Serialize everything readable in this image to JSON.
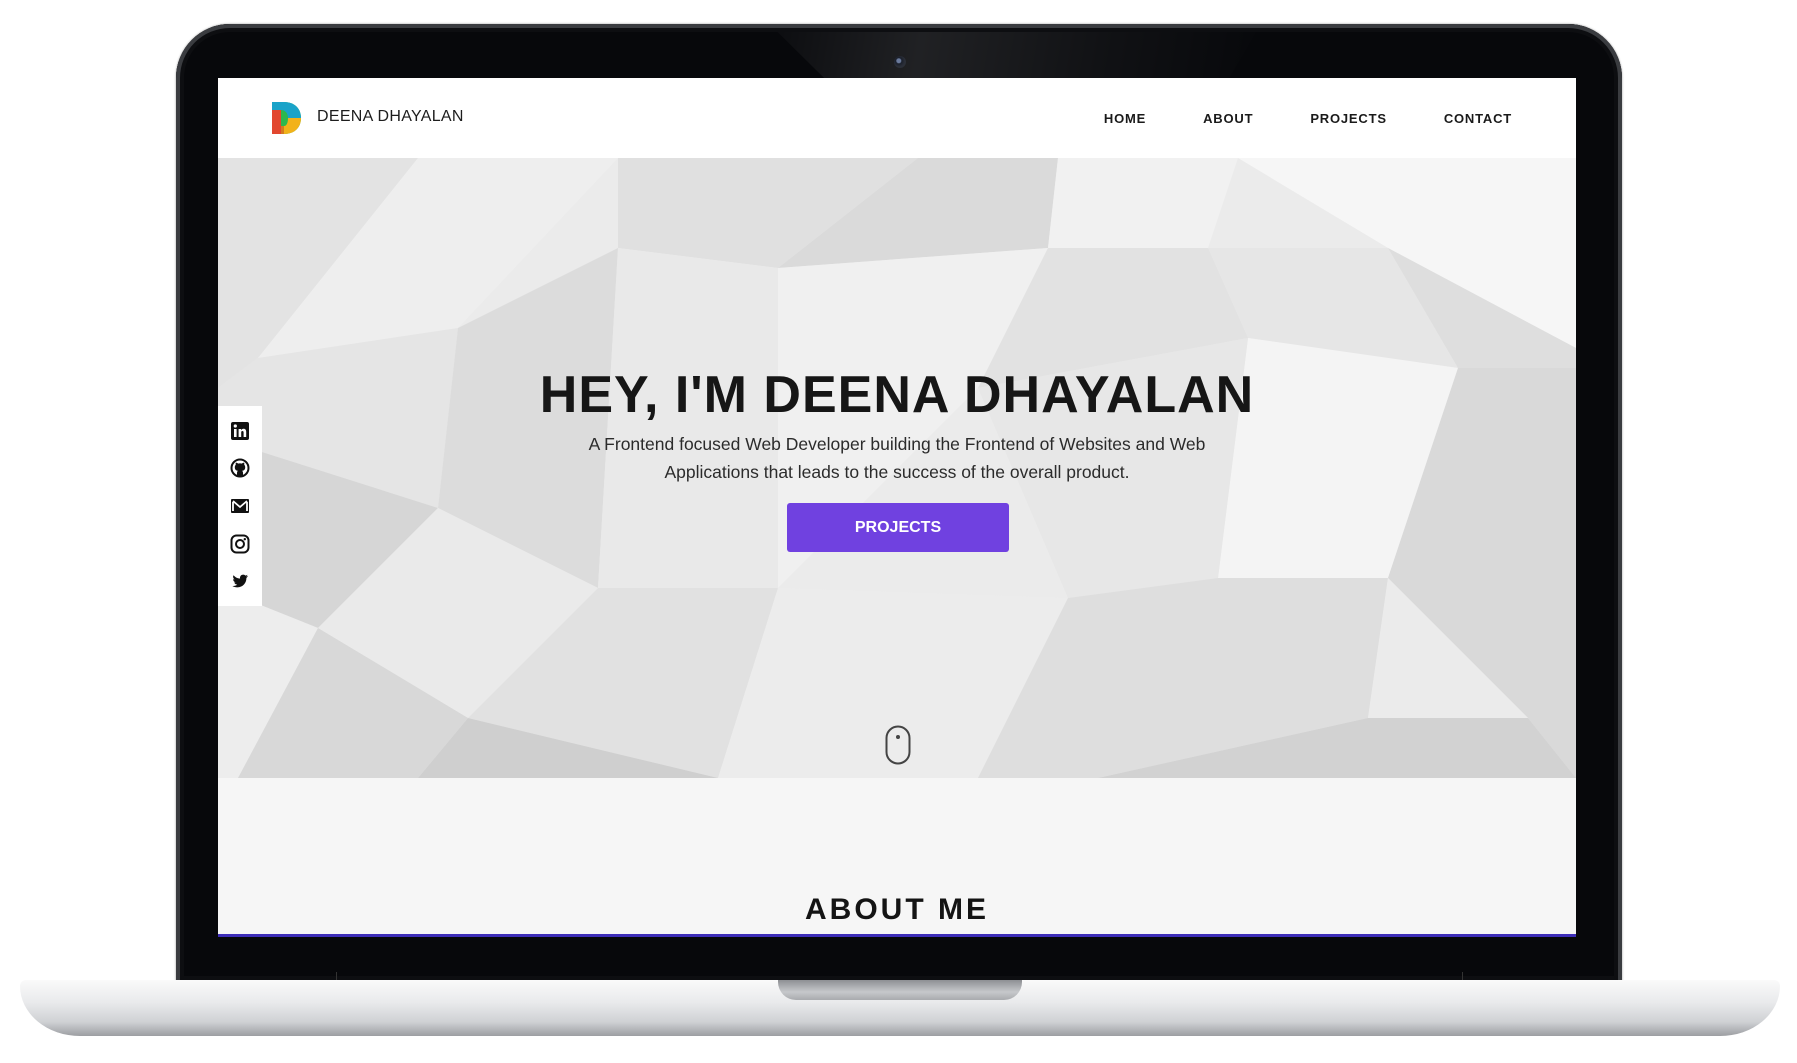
{
  "site": {
    "brand_name": "DEENA DHAYALAN",
    "accent_color": "#7041e0"
  },
  "nav": {
    "items": [
      {
        "label": "HOME"
      },
      {
        "label": "ABOUT"
      },
      {
        "label": "PROJECTS"
      },
      {
        "label": "CONTACT"
      }
    ]
  },
  "hero": {
    "title": "HEY, I'M DEENA DHAYALAN",
    "subtitle": "A Frontend focused Web Developer building the Frontend of Websites and Web Applications that leads to the success of the overall product.",
    "button_label": "PROJECTS"
  },
  "social": {
    "icons": [
      "linkedin-icon",
      "github-icon",
      "email-icon",
      "instagram-icon",
      "twitter-icon"
    ]
  },
  "about": {
    "title": "ABOUT ME"
  }
}
